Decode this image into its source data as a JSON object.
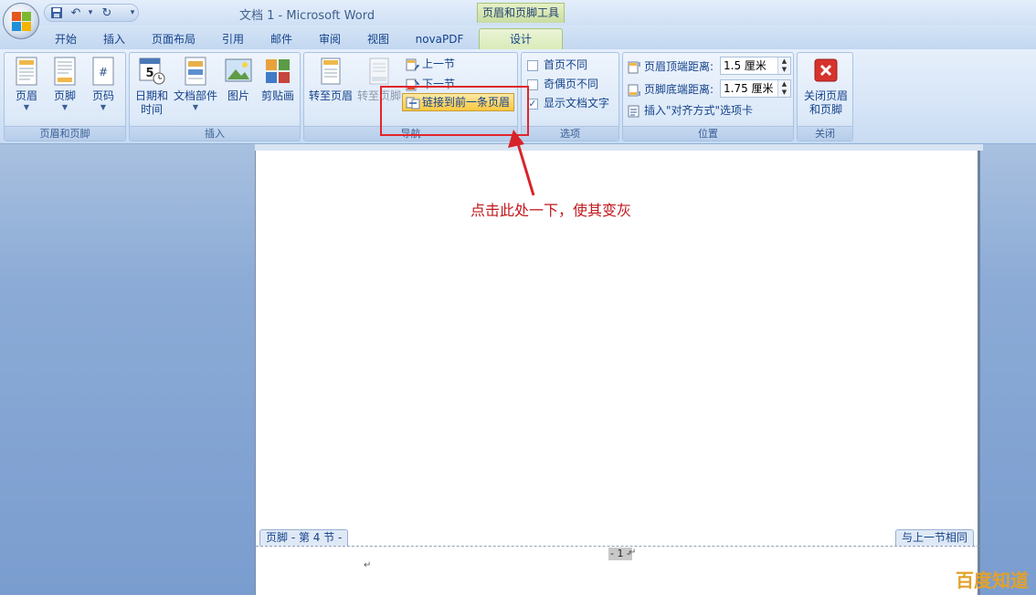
{
  "window": {
    "title": "文档 1 - Microsoft Word",
    "context_title": "页眉和页脚工具"
  },
  "quick_access": {
    "icons": [
      "save-icon",
      "undo-icon",
      "redo-icon",
      "customize-icon"
    ]
  },
  "tabs": [
    {
      "label": "开始"
    },
    {
      "label": "插入"
    },
    {
      "label": "页面布局"
    },
    {
      "label": "引用"
    },
    {
      "label": "邮件"
    },
    {
      "label": "审阅"
    },
    {
      "label": "视图"
    },
    {
      "label": "novaPDF"
    },
    {
      "label": "设计",
      "active": true
    }
  ],
  "ribbon": {
    "header_footer_group": {
      "label": "页眉和页脚",
      "header": "页眉",
      "footer": "页脚",
      "page_number": "页码"
    },
    "insert_group": {
      "label": "插入",
      "datetime_line1": "日期和",
      "datetime_line2": "时间",
      "quickparts": "文档部件",
      "picture": "图片",
      "clipart": "剪贴画"
    },
    "navigation_group": {
      "label": "导航",
      "goto_header": "转至页眉",
      "goto_footer": "转至页脚",
      "prev_section": "上一节",
      "next_section": "下一节",
      "link_previous": "链接到前一条页眉"
    },
    "options_group": {
      "label": "选项",
      "different_first": "首页不同",
      "different_odd_even": "奇偶页不同",
      "show_doc_text": "显示文档文字",
      "show_doc_text_checked": true
    },
    "position_group": {
      "label": "位置",
      "header_from_top_label": "页眉顶端距离:",
      "header_from_top_value": "1.5 厘米",
      "footer_from_bottom_label": "页脚底端距离:",
      "footer_from_bottom_value": "1.75 厘米",
      "insert_alignment_tab": "插入\"对齐方式\"选项卡"
    },
    "close_group": {
      "label": "关闭",
      "close_line1": "关闭页眉",
      "close_line2": "和页脚"
    }
  },
  "document": {
    "footer_tag": "页脚 - 第 4 节 -",
    "same_as_previous": "与上一节相同",
    "page_number_text": "- 1 -",
    "paragraph_mark": "↵"
  },
  "annotation": {
    "text": "点击此处一下，使其变灰",
    "color": "#c0181d"
  },
  "watermark": {
    "text": "百度知道"
  }
}
